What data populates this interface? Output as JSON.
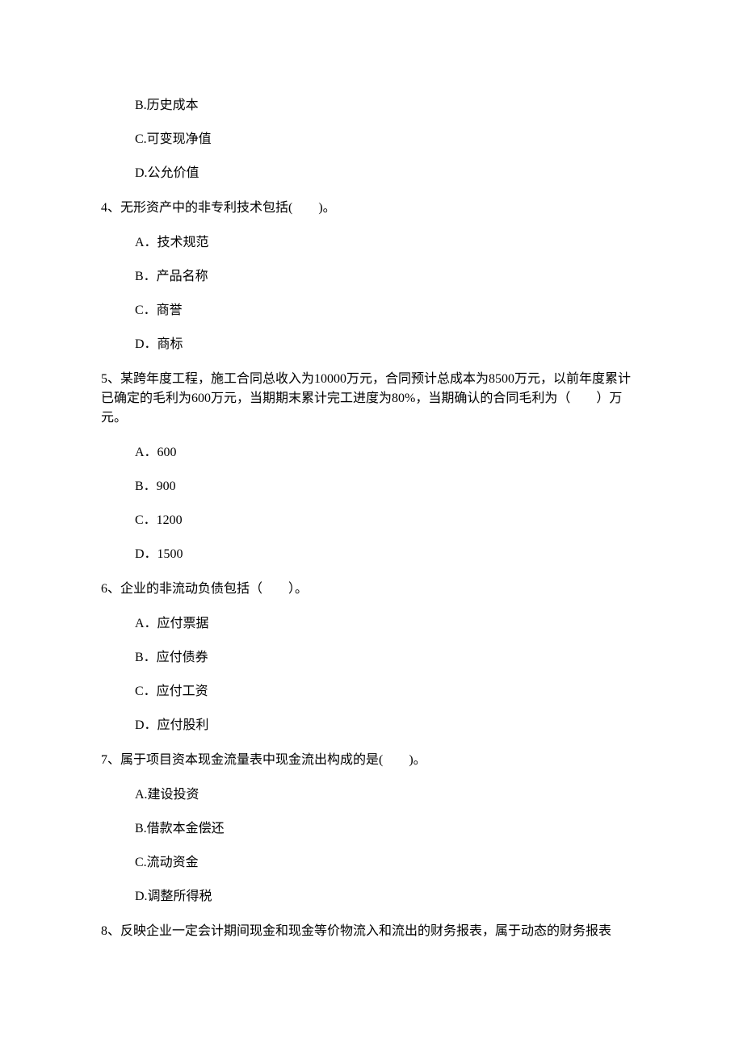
{
  "q3_options": {
    "b": "B.历史成本",
    "c": "C.可变现净值",
    "d": "D.公允价值"
  },
  "q4": {
    "stem": "4、无形资产中的非专利技术包括(　　)。",
    "a": "A．技术规范",
    "b": "B．产品名称",
    "c": "C．商誉",
    "d": "D．商标"
  },
  "q5": {
    "stem": "5、某跨年度工程，施工合同总收入为10000万元，合同预计总成本为8500万元，以前年度累计已确定的毛利为600万元，当期期末累计完工进度为80%，当期确认的合同毛利为（　　）万元。",
    "a": "A．600",
    "b": "B．900",
    "c": "C．1200",
    "d": "D．1500"
  },
  "q6": {
    "stem": "6、企业的非流动负债包括（　　）。",
    "a": "A．应付票据",
    "b": "B．应付债券",
    "c": "C．应付工资",
    "d": "D．应付股利"
  },
  "q7": {
    "stem": "7、属于项目资本现金流量表中现金流出构成的是(　　)。",
    "a": "A.建设投资",
    "b": "B.借款本金偿还",
    "c": "C.流动资金",
    "d": "D.调整所得税"
  },
  "q8": {
    "stem": "8、反映企业一定会计期间现金和现金等价物流入和流出的财务报表，属于动态的财务报表"
  }
}
